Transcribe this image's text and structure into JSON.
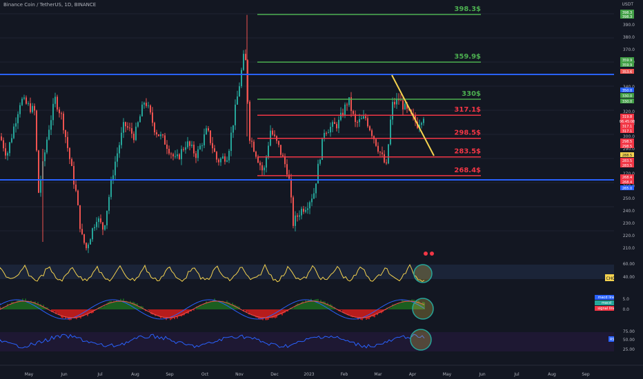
{
  "header": {
    "symbol_title": "Binance Coin / TetherUS, 1D, BINANCE",
    "unit": "USDT"
  },
  "price_scale": {
    "ticks": [
      "390.0",
      "380.0",
      "370.0",
      "360.0",
      "340.0",
      "320.0",
      "310.0",
      "300.0",
      "290.0",
      "270.0",
      "260.0",
      "250.0",
      "240.0",
      "230.0",
      "220.0",
      "210.0"
    ],
    "badges": [
      {
        "text": "398.3",
        "color": "#43a047"
      },
      {
        "text": "398.3",
        "color": "#43a047"
      },
      {
        "text": "359.9",
        "color": "#43a047"
      },
      {
        "text": "359.9",
        "color": "#43a047"
      },
      {
        "text": "353.6",
        "color": "#ef5350"
      },
      {
        "text": "350.0",
        "color": "#2962ff"
      },
      {
        "text": "330.0",
        "color": "#43a047"
      },
      {
        "text": "330.0",
        "color": "#43a047"
      },
      {
        "text": "319.8",
        "color": "#f23645"
      },
      {
        "text": "06:45:08",
        "color": "#f23645"
      },
      {
        "text": "317.1",
        "color": "#f23645"
      },
      {
        "text": "317.1",
        "color": "#f23645"
      },
      {
        "text": "298.5",
        "color": "#f23645"
      },
      {
        "text": "298.5",
        "color": "#f23645"
      },
      {
        "text": "288.5",
        "color": "#f5d34f"
      },
      {
        "text": "283.5",
        "color": "#f23645"
      },
      {
        "text": "283.5",
        "color": "#f23645"
      },
      {
        "text": "268.4",
        "color": "#f23645"
      },
      {
        "text": "268.4",
        "color": "#f23645"
      },
      {
        "text": "265.0",
        "color": "#2962ff"
      }
    ]
  },
  "levels": [
    {
      "value": 398.3,
      "label": "398.3$",
      "color": "#4caf50"
    },
    {
      "value": 359.9,
      "label": "359.9$",
      "color": "#4caf50"
    },
    {
      "value": 330.0,
      "label": "330$",
      "color": "#4caf50"
    },
    {
      "value": 317.1,
      "label": "317.1$",
      "color": "#f23645"
    },
    {
      "value": 298.5,
      "label": "298.5$",
      "color": "#f23645"
    },
    {
      "value": 283.5,
      "label": "283.5$",
      "color": "#f23645"
    },
    {
      "value": 268.4,
      "label": "268.4$",
      "color": "#f23645"
    }
  ],
  "horizontal_lines": [
    {
      "value": 350.0,
      "color": "#2962ff"
    },
    {
      "value": 265.0,
      "color": "#2962ff"
    }
  ],
  "indicators": {
    "chop": {
      "label": "CHOP",
      "ticks": [
        "60.00",
        "40.00"
      ]
    },
    "macd": {
      "labels": [
        "macd line",
        "macd",
        "signal line"
      ],
      "label_colors": [
        "#2962ff",
        "#26a69a",
        "#f23645"
      ],
      "ticks": [
        "5.0",
        "0.0"
      ]
    },
    "rsi": {
      "label": "RSI",
      "ticks": [
        "75.00",
        "50.00",
        "25.00"
      ]
    }
  },
  "time_axis": {
    "labels": [
      "May",
      "Jun",
      "Jul",
      "Aug",
      "Sep",
      "Oct",
      "Nov",
      "Dec",
      "2023",
      "Feb",
      "Mar",
      "Apr",
      "May",
      "Jun",
      "Jul",
      "Aug",
      "Sep"
    ]
  },
  "chart_data": {
    "type": "candlestick",
    "title": "Binance Coin / TetherUS, 1D, BINANCE",
    "ylim": [
      204,
      405
    ],
    "close_path_months": [
      "May",
      "Jun",
      "Jul",
      "Aug",
      "Sep",
      "Oct",
      "Nov",
      "Dec",
      "2023",
      "Feb",
      "Mar",
      "Apr"
    ],
    "approx_monthly_close": [
      300,
      215,
      250,
      315,
      275,
      285,
      295,
      290,
      250,
      330,
      300,
      320
    ]
  }
}
